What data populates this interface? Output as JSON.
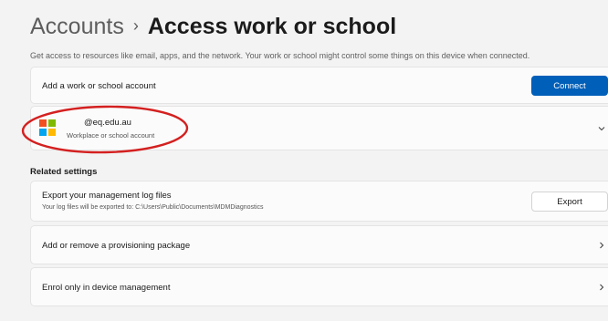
{
  "header": {
    "breadcrumb_parent": "Accounts",
    "separator": "›",
    "title": "Access work or school"
  },
  "description": "Get access to resources like email, apps, and the network. Your work or school might control some things on this device when connected.",
  "add_account": {
    "label": "Add a work or school account",
    "button_label": "Connect"
  },
  "account": {
    "email": "@eq.edu.au",
    "type": "Workplace or school account",
    "icon": "microsoft-logo-icon",
    "expand_icon": "chevron-down-icon"
  },
  "related_settings": {
    "heading": "Related settings",
    "export": {
      "title": "Export your management log files",
      "subtitle": "Your log files will be exported to: C:\\Users\\Public\\Documents\\MDMDiagnostics",
      "button_label": "Export"
    },
    "provisioning": {
      "label": "Add or remove a provisioning package",
      "icon": "chevron-right-icon"
    },
    "enrol": {
      "label": "Enrol only in device management",
      "icon": "chevron-right-icon"
    }
  },
  "colors": {
    "accent": "#005fb8",
    "annotation": "#d42020",
    "ms_red": "#f25022",
    "ms_green": "#7fba00",
    "ms_blue": "#00a4ef",
    "ms_yellow": "#ffb900"
  }
}
